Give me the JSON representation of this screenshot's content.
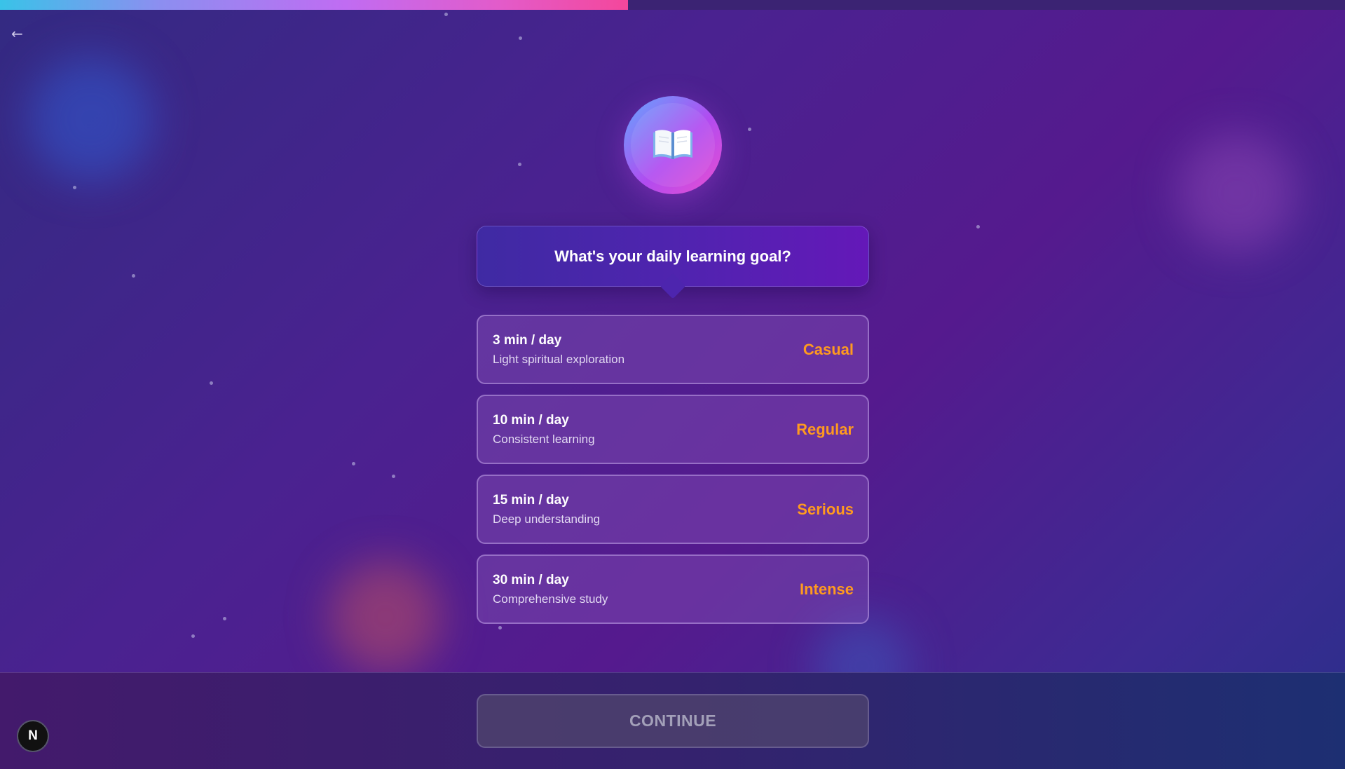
{
  "progress": {
    "fraction": 0.467
  },
  "nav": {
    "back_icon": "←"
  },
  "hero": {
    "icon": "📖",
    "icon_name": "open-book-icon"
  },
  "question": {
    "text": "What's your daily learning goal?"
  },
  "options": [
    {
      "title": "3 min / day",
      "subtitle": "Light spiritual exploration",
      "tag": "Casual"
    },
    {
      "title": "10 min / day",
      "subtitle": "Consistent learning",
      "tag": "Regular"
    },
    {
      "title": "15 min / day",
      "subtitle": "Deep understanding",
      "tag": "Serious"
    },
    {
      "title": "30 min / day",
      "subtitle": "Comprehensive study",
      "tag": "Intense"
    }
  ],
  "footer": {
    "continue_label": "CONTINUE"
  },
  "badge": {
    "letter": "N"
  },
  "colors": {
    "accent_tag": "#ff9a1f",
    "question_bg": "#5123b0",
    "progress_end": "#f4479b"
  }
}
